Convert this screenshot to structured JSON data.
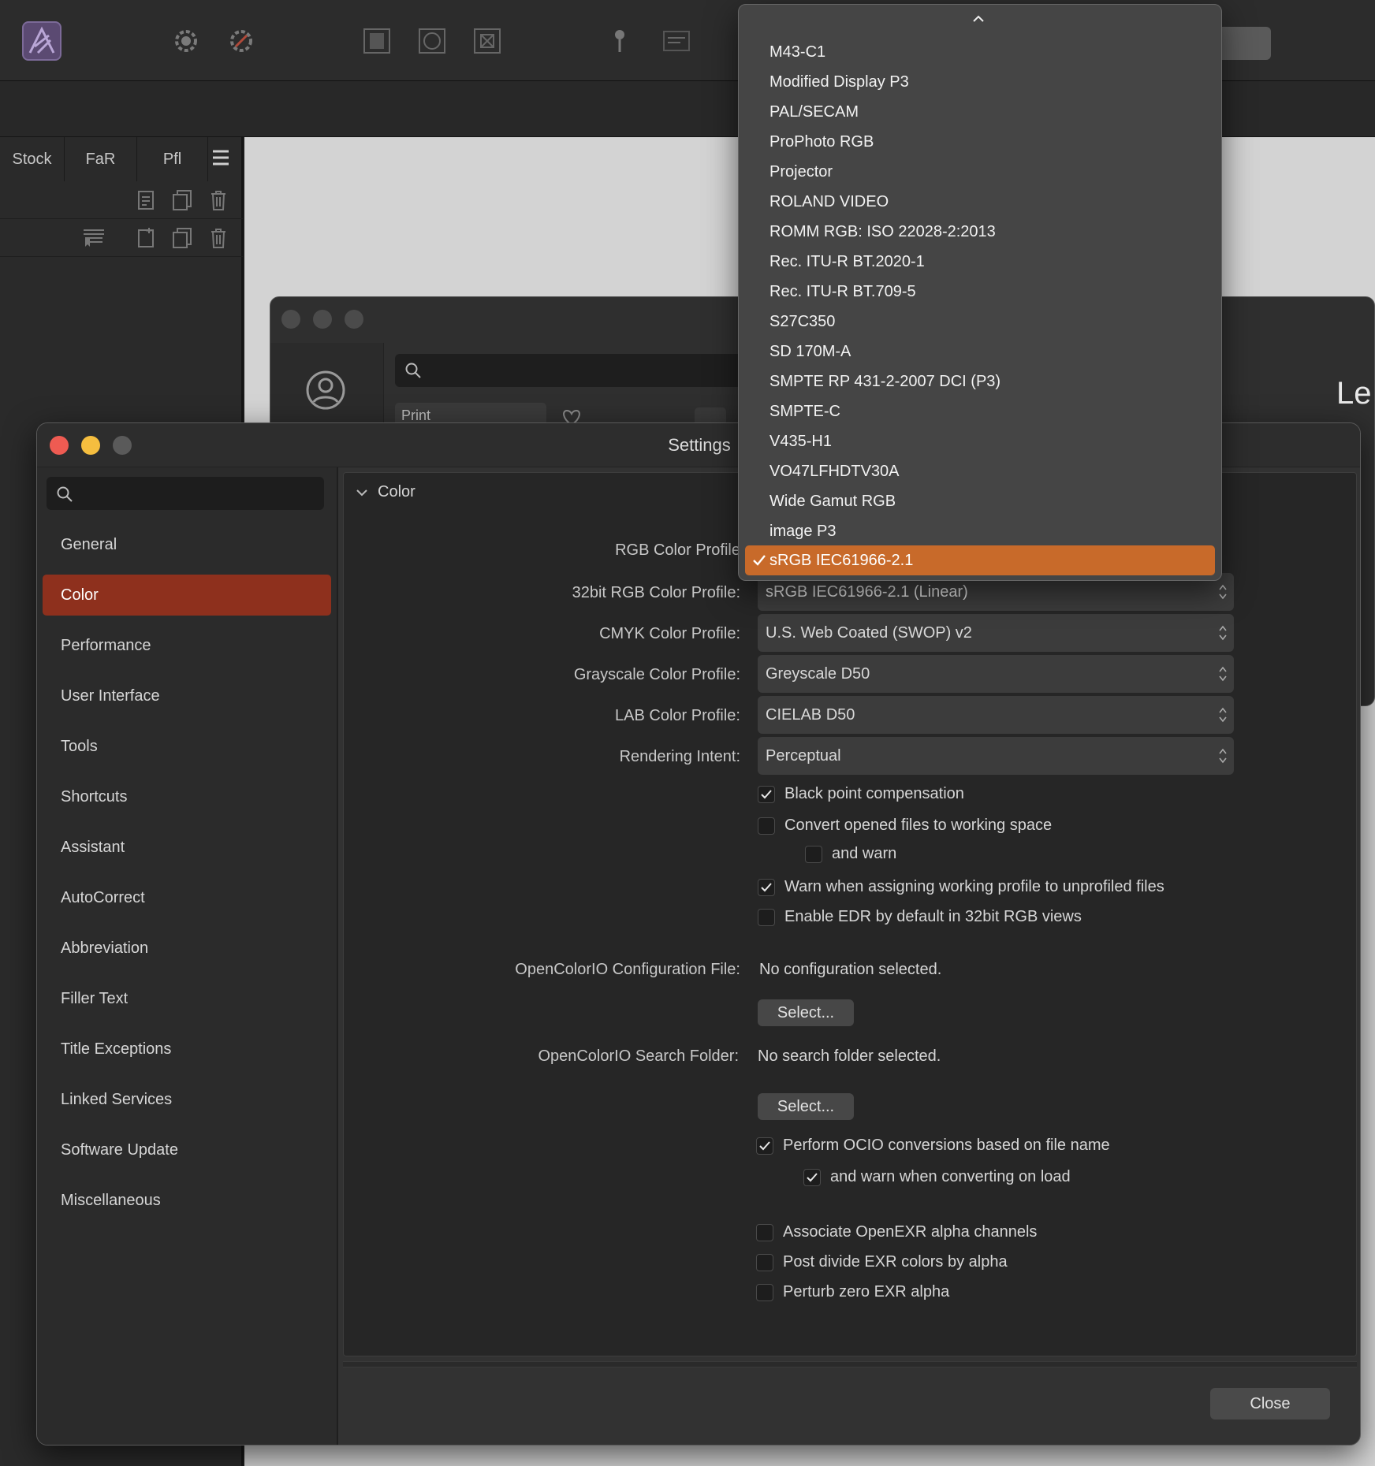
{
  "colors": {
    "accent_selected": "#8e301d",
    "menu_highlight": "#c86a2a"
  },
  "left_panel": {
    "tabs": [
      "Stock",
      "FaR",
      "Pfl"
    ]
  },
  "settings": {
    "title": "Settings",
    "sidebar": {
      "items": [
        "General",
        "Color",
        "Performance",
        "User Interface",
        "Tools",
        "Shortcuts",
        "Assistant",
        "AutoCorrect",
        "Abbreviation",
        "Filler Text",
        "Title Exceptions",
        "Linked Services",
        "Software Update",
        "Miscellaneous"
      ],
      "selected": "Color"
    },
    "section": "Color",
    "fields": {
      "rgb_label": "RGB Color Profile",
      "rgb32_label": "32bit RGB Color Profile:",
      "rgb32_value": "sRGB IEC61966-2.1 (Linear)",
      "cmyk_label": "CMYK Color Profile:",
      "cmyk_value": "U.S. Web Coated (SWOP) v2",
      "gray_label": "Grayscale Color Profile:",
      "gray_value": "Greyscale D50",
      "lab_label": "LAB Color Profile:",
      "lab_value": "CIELAB D50",
      "intent_label": "Rendering Intent:",
      "intent_value": "Perceptual"
    },
    "checkboxes": {
      "black_point": {
        "label": "Black point compensation",
        "checked": true
      },
      "convert_opened": {
        "label": "Convert opened files to working space",
        "checked": false
      },
      "and_warn": {
        "label": "and warn",
        "checked": false
      },
      "warn_assigning": {
        "label": "Warn when assigning working profile to unprofiled files",
        "checked": true
      },
      "enable_edr": {
        "label": "Enable EDR by default in 32bit RGB views",
        "checked": false
      },
      "perform_ocio": {
        "label": "Perform OCIO conversions based on file name",
        "checked": true
      },
      "warn_converting": {
        "label": "and warn when converting on load",
        "checked": true
      },
      "associate_exr": {
        "label": "Associate OpenEXR alpha channels",
        "checked": false
      },
      "post_divide": {
        "label": "Post divide EXR colors by alpha",
        "checked": false
      },
      "perturb_zero": {
        "label": "Perturb zero EXR alpha",
        "checked": false
      }
    },
    "ocio": {
      "config_label": "OpenColorIO Configuration File:",
      "config_value": "No configuration selected.",
      "folder_label": "OpenColorIO Search Folder:",
      "folder_value": "No search folder selected.",
      "select_label": "Select..."
    },
    "close_label": "Close"
  },
  "dropdown": {
    "items": [
      "M43-C1",
      "Modified Display P3",
      "PAL/SECAM",
      "ProPhoto RGB",
      "Projector",
      "ROLAND VIDEO",
      "ROMM RGB: ISO 22028-2:2013",
      "Rec. ITU-R BT.2020-1",
      "Rec. ITU-R BT.709-5",
      "S27C350",
      "SD 170M-A",
      "SMPTE RP 431-2-2007 DCI (P3)",
      "SMPTE-C",
      "V435-H1",
      "VO47LFHDTV30A",
      "Wide Gamut RGB",
      "image P3"
    ],
    "selected": "sRGB IEC61966-2.1"
  },
  "background_window": {
    "heading_fragment": "Le",
    "print_fragment": "Print"
  }
}
